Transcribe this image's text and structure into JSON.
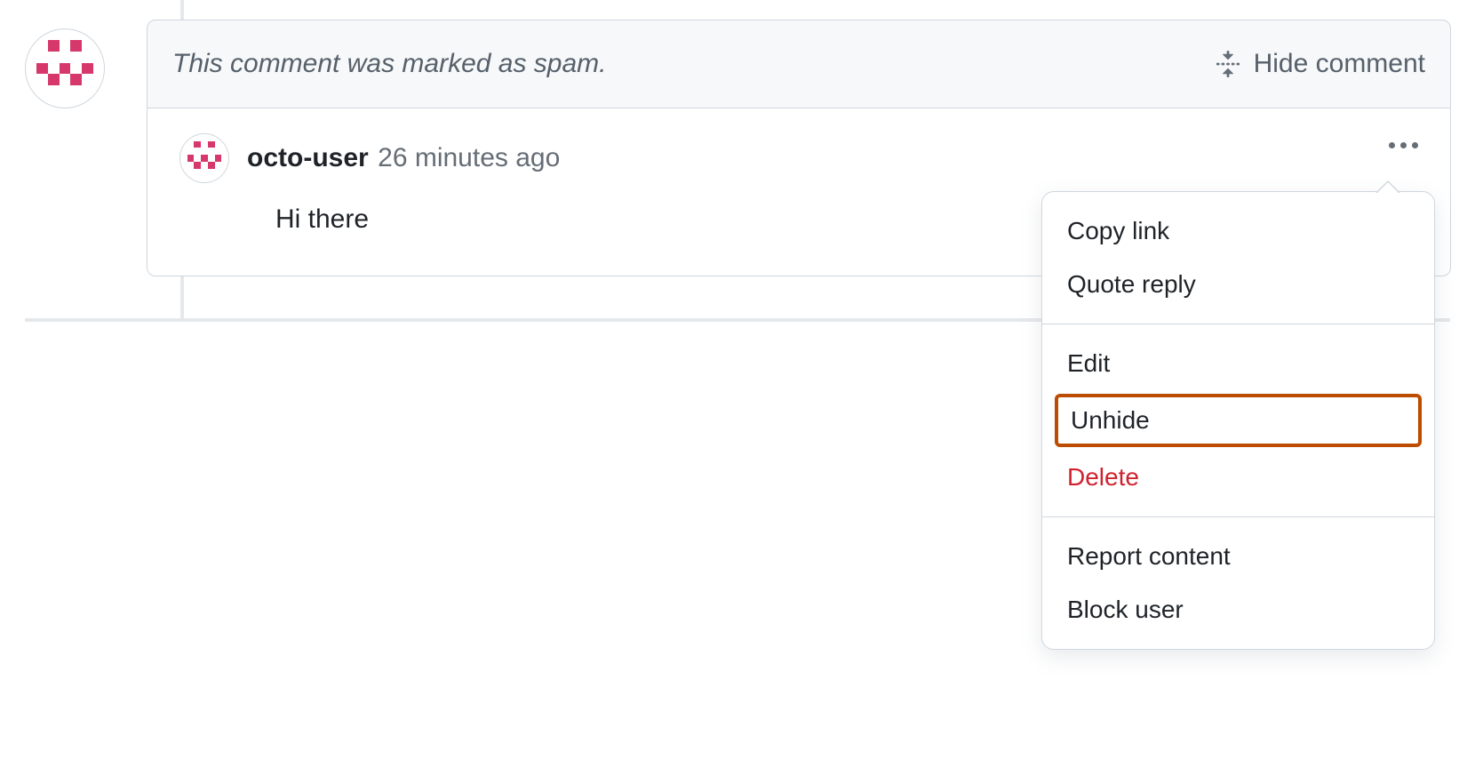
{
  "spam_banner": {
    "text": "This comment was marked as spam.",
    "hide_label": "Hide comment"
  },
  "comment": {
    "username": "octo-user",
    "timestamp": "26 minutes ago",
    "body": "Hi there"
  },
  "menu": {
    "copy_link": "Copy link",
    "quote_reply": "Quote reply",
    "edit": "Edit",
    "unhide": "Unhide",
    "delete": "Delete",
    "report_content": "Report content",
    "block_user": "Block user"
  }
}
